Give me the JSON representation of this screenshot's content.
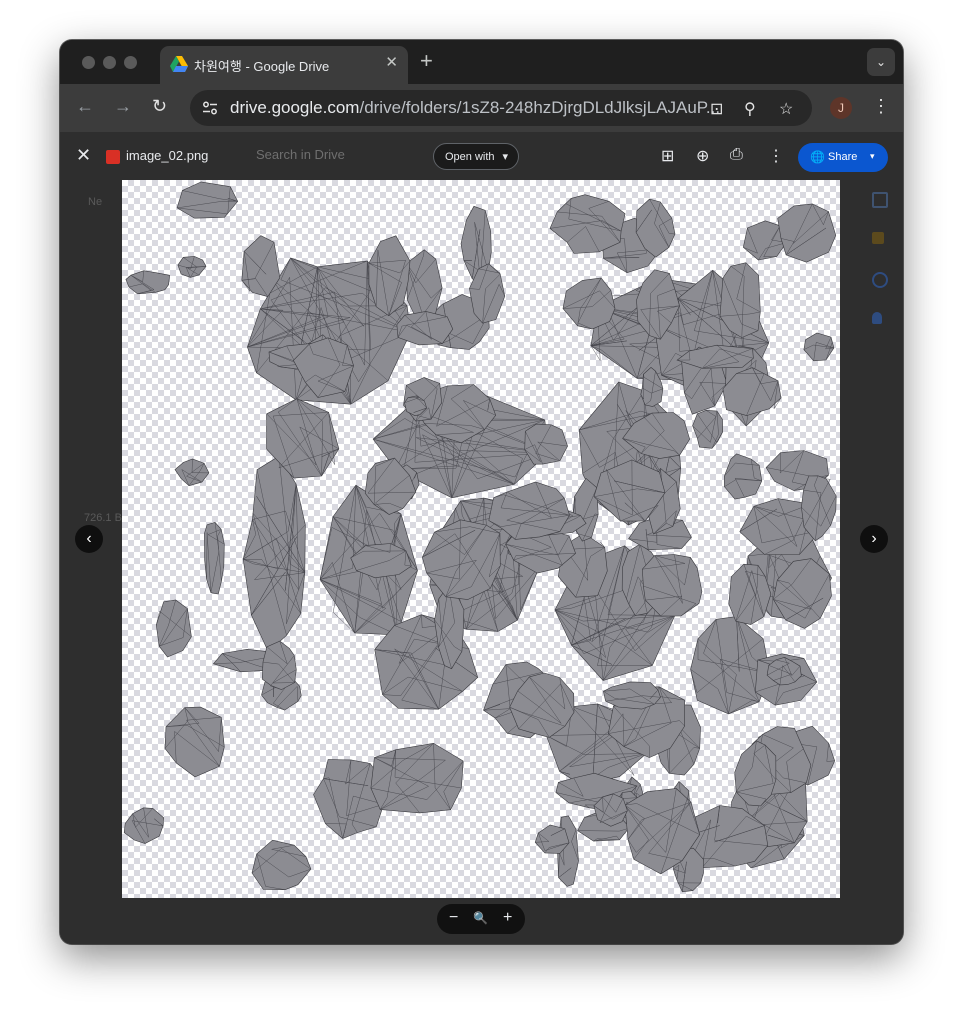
{
  "browser": {
    "tab_title": "차원여행 - Google Drive",
    "tab_close": "✕",
    "new_tab": "+",
    "tab_menu": "⌄",
    "back": "←",
    "forward": "→",
    "reload": "↻",
    "url_host": "drive.google.com",
    "url_path": "/drive/folders/1sZ8-248hzDjrgDLdJlksjLAJAuP...",
    "avatar_letter": "J",
    "menu": "⋮"
  },
  "viewer": {
    "close": "✕",
    "file_name": "image_02.png",
    "search_placeholder": "Search in Drive",
    "open_with_label": "Open with",
    "open_with_caret": "▾",
    "share_label": "Share",
    "share_caret": "▾",
    "prev": "‹",
    "next": "›",
    "zoom_out": "−",
    "zoom_reset": "🔍",
    "zoom_in": "+"
  },
  "background_sidebar": {
    "new_label": "Ne",
    "storage_text": "726.1 B"
  },
  "colors": {
    "share_blue": "#0b57d0",
    "tile_gray": "#8c8c92",
    "checker": "#d9d9e0"
  }
}
